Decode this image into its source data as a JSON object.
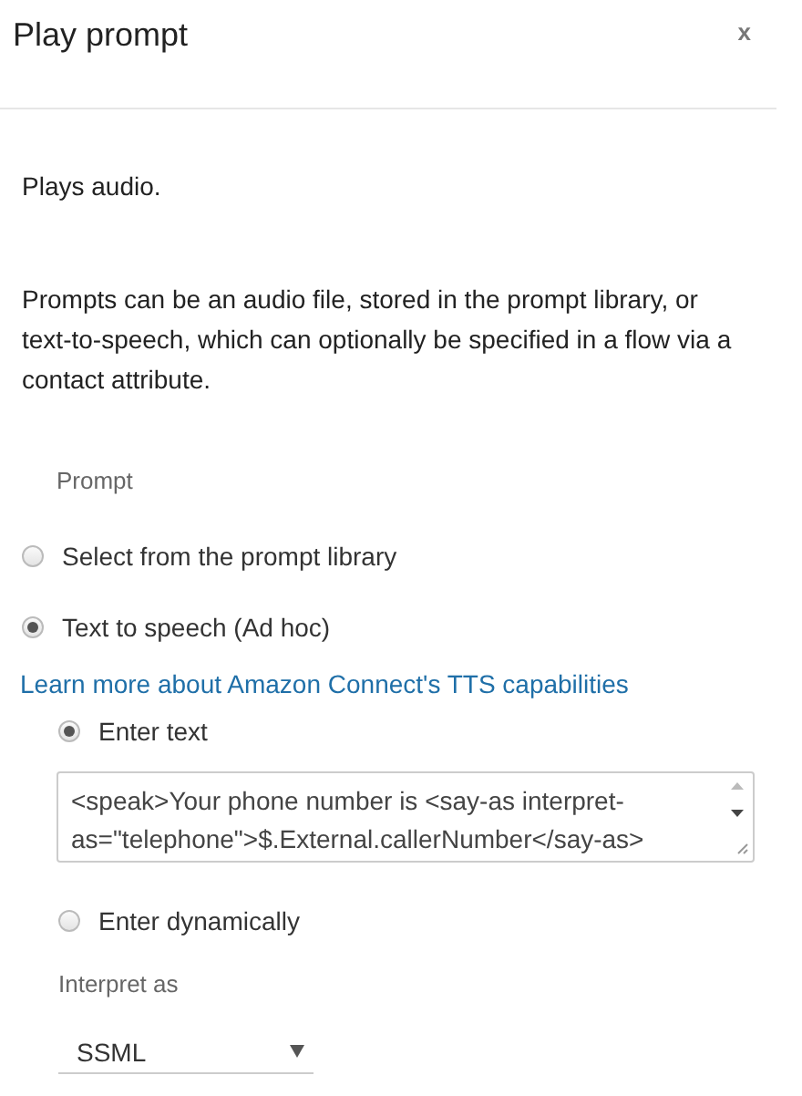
{
  "panel": {
    "title": "Play prompt",
    "close": "x"
  },
  "description": "Plays audio.",
  "info": "Prompts can be an audio file, stored in the prompt library, or text-to-speech, which can optionally be specified in a flow via a contact attribute.",
  "prompt_label": "Prompt",
  "prompt_options": [
    {
      "label": "Select from the prompt library",
      "selected": false
    },
    {
      "label": "Text to speech (Ad hoc)",
      "selected": true
    }
  ],
  "link": "Learn more about Amazon Connect's TTS capabilities",
  "text_options": [
    {
      "label": "Enter text",
      "selected": true,
      "kind": "text"
    },
    {
      "label": "Enter dynamically",
      "selected": false,
      "kind": "plain"
    }
  ],
  "text_value": "<speak>Your phone number is <say-as interpret-as=\"telephone\">$.External.callerNumber</say-as>",
  "interpret_label": "Interpret as",
  "interpret_value": "SSML"
}
